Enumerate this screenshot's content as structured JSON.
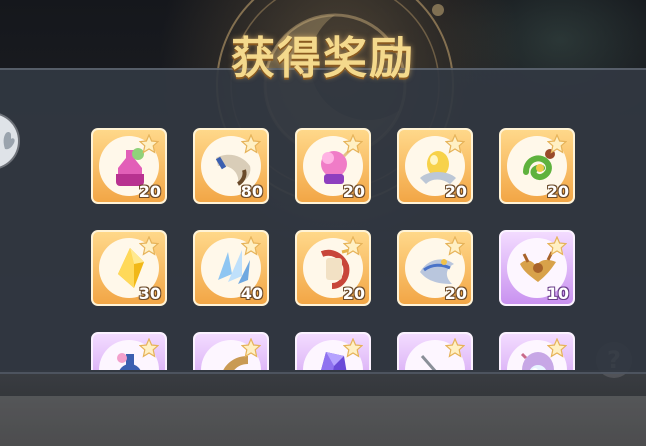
{
  "dialog": {
    "title": "获得奖励",
    "help_icon": "question-icon",
    "side_button_icon": "hand-icon"
  },
  "colors": {
    "gold_frame": "#f2a646",
    "purple_frame": "#c992f0",
    "title": "#f4d98c"
  },
  "rewards": [
    {
      "icon": "potion-bottle-icon",
      "quantity": "20",
      "rarity": "gold"
    },
    {
      "icon": "horn-icon",
      "quantity": "80",
      "rarity": "gold"
    },
    {
      "icon": "pink-flower-pot-icon",
      "quantity": "20",
      "rarity": "gold"
    },
    {
      "icon": "golden-egg-icon",
      "quantity": "20",
      "rarity": "gold"
    },
    {
      "icon": "green-serpent-icon",
      "quantity": "20",
      "rarity": "gold"
    },
    {
      "icon": "yellow-crystal-icon",
      "quantity": "30",
      "rarity": "gold"
    },
    {
      "icon": "ice-shard-icon",
      "quantity": "40",
      "rarity": "gold"
    },
    {
      "icon": "red-scroll-icon",
      "quantity": "20",
      "rarity": "gold"
    },
    {
      "icon": "silver-dragon-icon",
      "quantity": "20",
      "rarity": "gold"
    },
    {
      "icon": "bat-wing-icon",
      "quantity": "10",
      "rarity": "purple"
    },
    {
      "icon": "blue-flask-icon",
      "quantity": "",
      "rarity": "purple"
    },
    {
      "icon": "brass-horn-icon",
      "quantity": "",
      "rarity": "purple"
    },
    {
      "icon": "purple-crystal-icon",
      "quantity": "",
      "rarity": "purple"
    },
    {
      "icon": "gold-pendant-icon",
      "quantity": "",
      "rarity": "purple"
    },
    {
      "icon": "pearl-shell-icon",
      "quantity": "",
      "rarity": "purple"
    }
  ]
}
